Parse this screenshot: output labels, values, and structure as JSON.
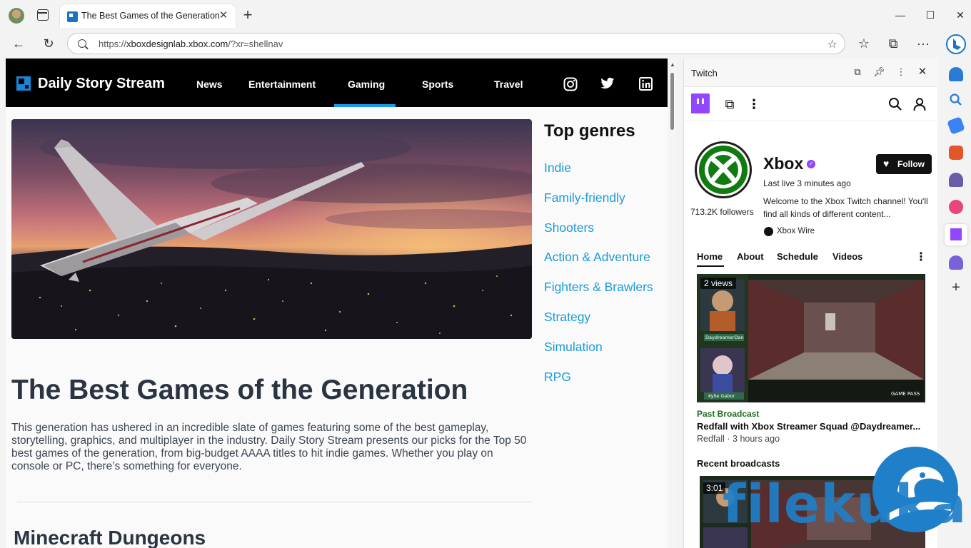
{
  "browser": {
    "tab_title": "The Best Games of the Generation",
    "url_host_prefix": "https://",
    "url_host": "xboxdesignlab.xbox.com",
    "url_path": "/?xr=shellnav"
  },
  "site": {
    "name": "Daily Story Stream",
    "nav": [
      "News",
      "Entertainment",
      "Gaming",
      "Sports",
      "Travel"
    ],
    "active_nav": "Gaming",
    "social": [
      "instagram-icon",
      "twitter-icon",
      "linkedin-icon"
    ]
  },
  "genres": {
    "title": "Top genres",
    "items": [
      "Indie",
      "Family-friendly",
      "Shooters",
      "Action & Adventure",
      "Fighters & Brawlers",
      "Strategy",
      "Simulation",
      "RPG"
    ]
  },
  "article": {
    "title": "The Best Games of the Generation",
    "body": "This generation has ushered in an incredible slate of games featuring some of the best gameplay, storytelling, graphics, and multiplayer in the industry. Daily Story Stream presents our picks for the Top 50 best games of the generation, from big-budget AAAA titles to hit indie games. Whether you play on console or PC, there’s something for everyone.",
    "next_heading": "Minecraft Dungeons"
  },
  "panel": {
    "title": "Twitch",
    "channel": {
      "name": "Xbox",
      "last_live": "Last live 3 minutes ago",
      "followers": "713.2K followers",
      "description": "Welcome to the Xbox Twitch channel! You'll find all kinds of different content...",
      "team": "Xbox Wire",
      "follow_label": "Follow"
    },
    "tabs": [
      "Home",
      "About",
      "Schedule",
      "Videos"
    ],
    "active_tab": "Home",
    "video": {
      "views": "2 views",
      "category_label": "Past Broadcast",
      "title": "Redfall with Xbox Streamer Squad @Daydreamer...",
      "meta": "Redfall · 3 hours ago",
      "streamer_1": "DaydreamerDan",
      "streamer_2": "Kylie Gabor",
      "gamepass": "GAME PASS"
    },
    "recent_title": "Recent broadcasts",
    "recent_duration": "3:01"
  },
  "watermark": "filekuka",
  "colors": {
    "accent": "#1a9bf0",
    "genre_link": "#1a9bd6",
    "twitch_purple": "#9146ff",
    "xbox_green": "#107c10"
  }
}
